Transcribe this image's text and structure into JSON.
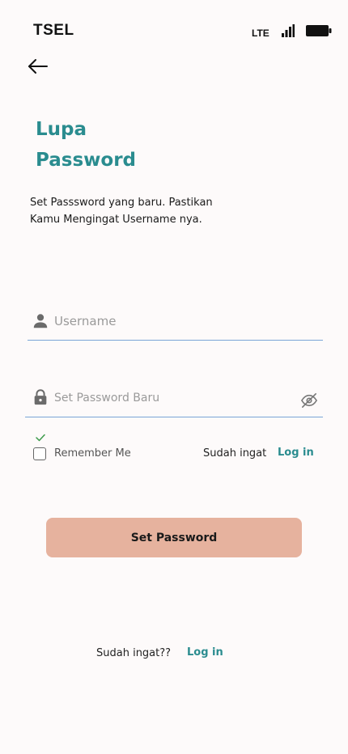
{
  "status_bar": {
    "carrier": "TSEL",
    "network": "LTE",
    "signal_icon": "signal-bars-icon",
    "battery_icon": "battery-icon"
  },
  "nav": {
    "back_icon": "arrow-left-icon"
  },
  "title": {
    "line1": "Lupa",
    "line2": "Password"
  },
  "description": {
    "line1": "Set Passsword yang baru. Pastikan",
    "line2": "Kamu Mengingat Username nya."
  },
  "form": {
    "username": {
      "placeholder": "Username",
      "value": "",
      "icon": "user-icon"
    },
    "password": {
      "placeholder": "Set Password Baru",
      "value": "",
      "icon": "lock-icon",
      "toggle_icon": "eye-off-icon"
    },
    "remember_label": "Remember Me",
    "remember_checked": false,
    "inline_prompt": "Sudah ingat",
    "inline_login": "Log in"
  },
  "submit": {
    "label": "Set Password"
  },
  "footer": {
    "prompt": "Sudah ingat??",
    "login": "Log in"
  },
  "colors": {
    "accent": "#2a8c8f",
    "button": "#e6b29e",
    "underline": "#7aa5d6",
    "background": "#fdfafa"
  }
}
